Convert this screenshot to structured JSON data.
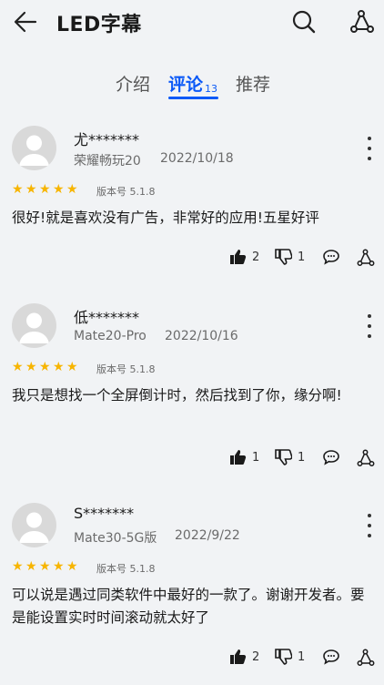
{
  "header": {
    "title": "LED字幕",
    "back_icon": "arrow-left-icon",
    "search_icon": "search-icon",
    "share_icon": "share-icon"
  },
  "tabs": [
    {
      "label": "介绍"
    },
    {
      "label": "评论",
      "count": "13",
      "active": true
    },
    {
      "label": "推荐"
    }
  ],
  "accent_color": "#0a59f7",
  "star_color": "#f7b500",
  "reviews": [
    {
      "user": "尤*******",
      "device": "荣耀畅玩20",
      "date": "2022/10/18",
      "rating": 5,
      "version": "版本号 5.1.8",
      "text": "很好!就是喜欢没有广告，非常好的应用!五星好评",
      "likes": "2",
      "dislikes": "1"
    },
    {
      "user": "低*******",
      "device": "Mate20-Pro",
      "date": "2022/10/16",
      "rating": 5,
      "version": "版本号 5.1.8",
      "text": "我只是想找一个全屏倒计时，然后找到了你，缘分啊!",
      "likes": "1",
      "dislikes": "1"
    },
    {
      "user": "S*******",
      "device": "Mate30-5G版",
      "date": "2022/9/22",
      "rating": 5,
      "version": "版本号 5.1.8",
      "text": "可以说是遇过同类软件中最好的一款了。谢谢开发者。要是能设置实时时间滚动就太好了",
      "likes": "2",
      "dislikes": "1"
    }
  ]
}
